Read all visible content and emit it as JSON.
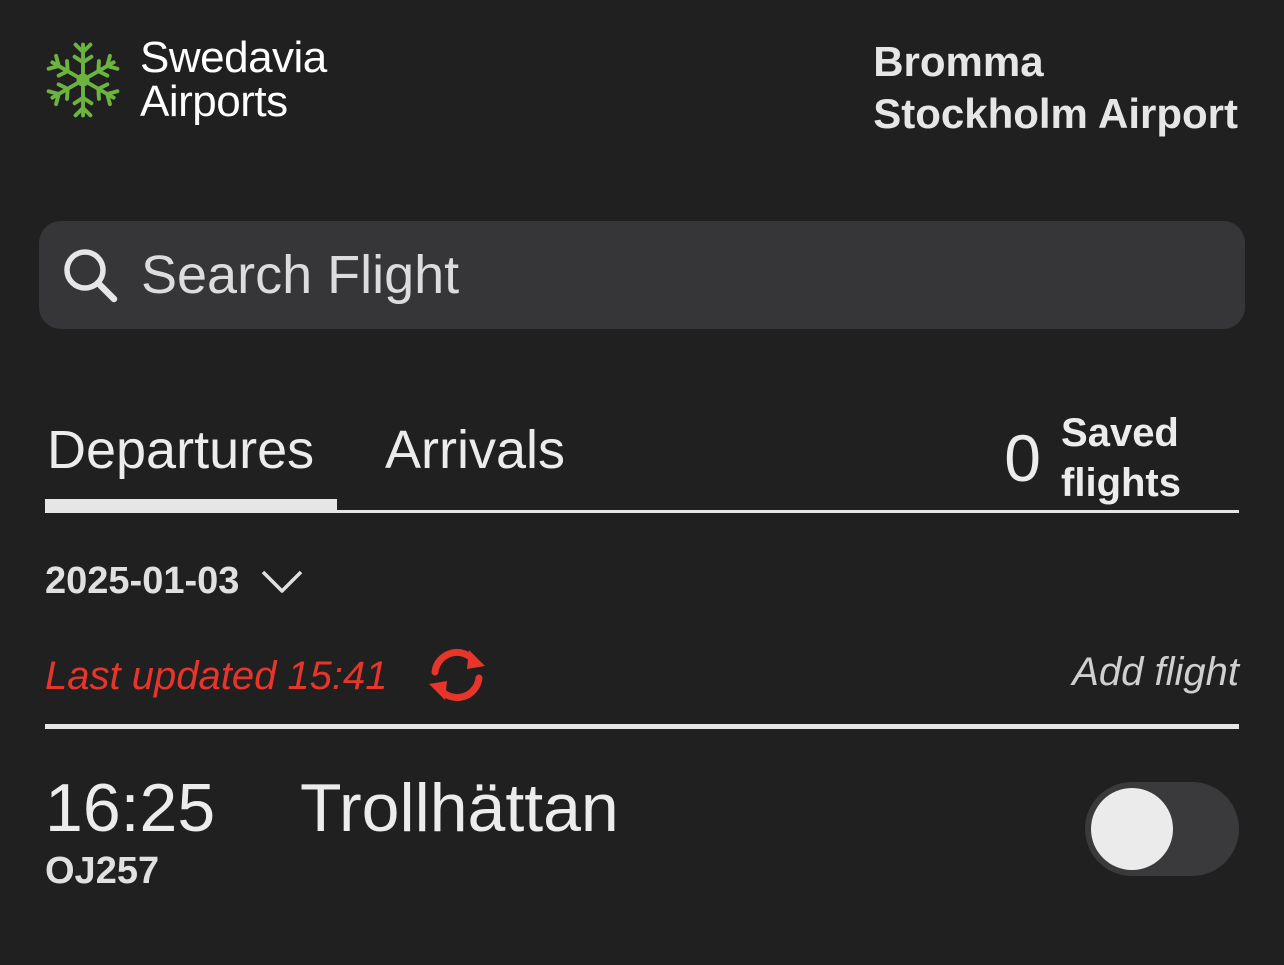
{
  "header": {
    "brand": {
      "line1": "Swedavia",
      "line2": "Airports",
      "logo_icon": "snowflake-logo-icon",
      "logo_color": "#6cb33f"
    },
    "airport": {
      "line1": "Bromma",
      "line2": "Stockholm Airport"
    }
  },
  "search": {
    "placeholder": "Search Flight",
    "value": "",
    "icon": "search-icon"
  },
  "tabs": {
    "items": [
      {
        "label": "Departures",
        "active": true
      },
      {
        "label": "Arrivals",
        "active": false
      }
    ],
    "saved": {
      "count": "0",
      "label_line1": "Saved",
      "label_line2": "flights"
    }
  },
  "date_select": {
    "value": "2025-01-03",
    "icon": "chevron-down-icon"
  },
  "status": {
    "last_updated": "Last updated 15:41",
    "refresh_icon": "refresh-icon",
    "add_flight": "Add flight",
    "alert_color": "#e8352b"
  },
  "flights": [
    {
      "time": "16:25",
      "destination": "Trollhättan",
      "flight_number": "OJ257",
      "saved": false
    }
  ]
}
